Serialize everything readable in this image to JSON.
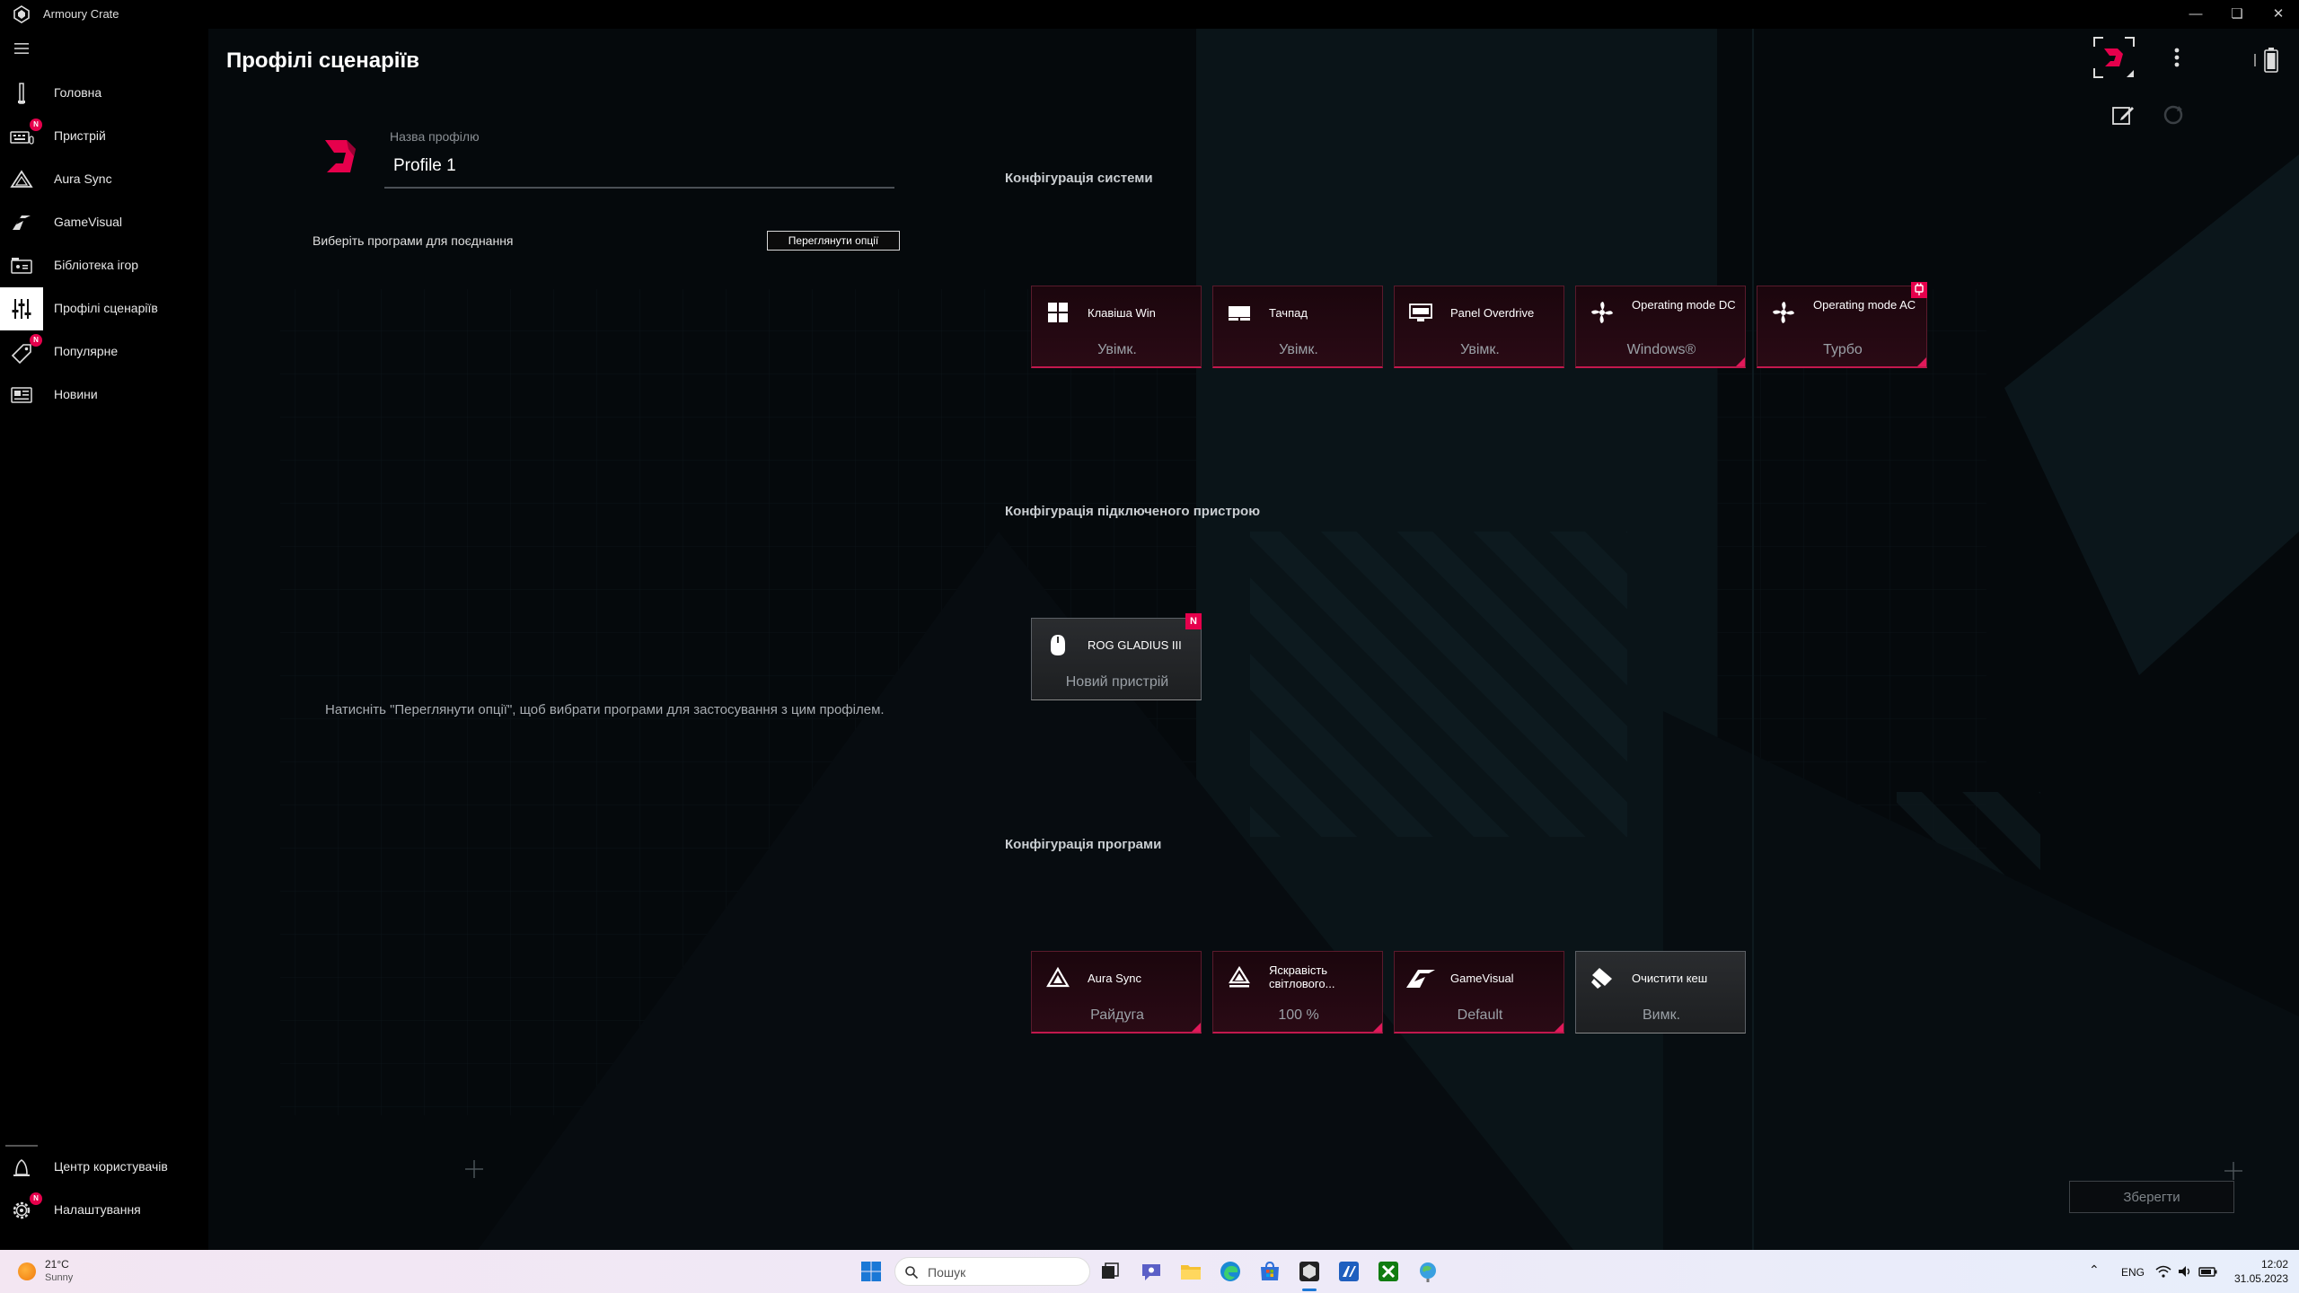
{
  "window": {
    "title": "Armoury Crate"
  },
  "sidebar": {
    "items": [
      {
        "label": "Головна",
        "badge": ""
      },
      {
        "label": "Пристрій",
        "badge": "N"
      },
      {
        "label": "Aura Sync",
        "badge": ""
      },
      {
        "label": "GameVisual",
        "badge": ""
      },
      {
        "label": "Бібліотека ігор",
        "badge": ""
      },
      {
        "label": "Профілі сценаріїв",
        "badge": ""
      },
      {
        "label": "Популярне",
        "badge": "N"
      },
      {
        "label": "Новини",
        "badge": ""
      }
    ],
    "bottom_items": [
      {
        "label": "Центр користувачів",
        "badge": ""
      },
      {
        "label": "Налаштування",
        "badge": "N"
      }
    ]
  },
  "page": {
    "title": "Профілі сценаріїв",
    "profile_name_label": "Назва профілю",
    "profile_name": "Profile 1",
    "choose_programs_label": "Виберіть програми для поєднання",
    "view_options_button": "Переглянути опції",
    "hint": "Натисніть \"Переглянути опції\", щоб вибрати програми для застосування з цим профілем.",
    "save_button": "Зберегти"
  },
  "sections": {
    "system": {
      "title": "Конфігурація системи",
      "cards": [
        {
          "title": "Клавіша Win",
          "value": "Увімк.",
          "icon": "windows-icon"
        },
        {
          "title": "Тачпад",
          "value": "Увімк.",
          "icon": "touchpad-icon"
        },
        {
          "title": "Panel Overdrive",
          "value": "Увімк.",
          "icon": "panel-overdrive-icon"
        },
        {
          "title": "Operating mode DC",
          "value": "Windows®",
          "icon": "fan-icon"
        },
        {
          "title": "Operating mode AC",
          "value": "Турбо",
          "icon": "fan-icon"
        }
      ]
    },
    "device": {
      "title": "Конфігурація підключеного пристрою",
      "cards": [
        {
          "title": "ROG GLADIUS III",
          "value": "Новий пристрій",
          "icon": "mouse-icon",
          "badge": "N"
        }
      ]
    },
    "program": {
      "title": "Конфігурація програми",
      "cards": [
        {
          "title": "Aura Sync",
          "value": "Райдуга",
          "icon": "aura-sync-icon"
        },
        {
          "title": "Яскравість світлового...",
          "value": "100 %",
          "icon": "aura-brightness-icon"
        },
        {
          "title": "GameVisual",
          "value": "Default",
          "icon": "gamevisual-icon"
        },
        {
          "title": "Очистити кеш",
          "value": "Вимк.",
          "icon": "clear-cache-icon"
        }
      ]
    }
  },
  "taskbar": {
    "weather_temp": "21°C",
    "weather_cond": "Sunny",
    "search_placeholder": "Пошук",
    "language": "ENG",
    "time": "12:02",
    "date": "31.05.2023"
  },
  "colors": {
    "accent": "#e6004c",
    "card_bg": "#1e0810",
    "main_bg": "#05090c"
  }
}
